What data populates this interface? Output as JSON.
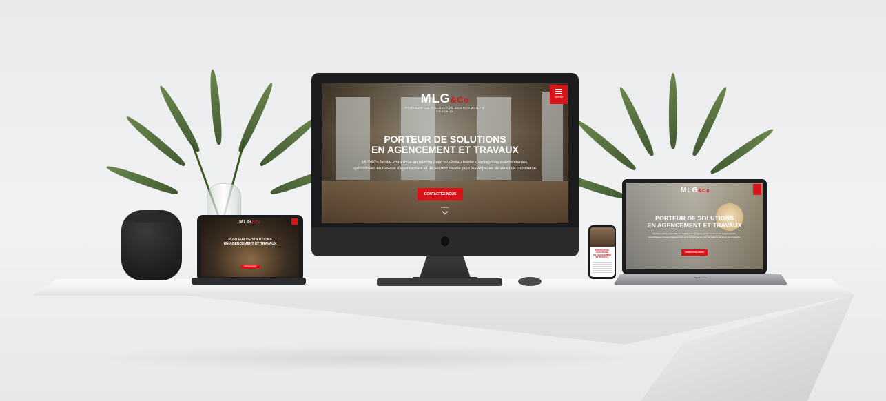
{
  "brand": {
    "logo_main": "MLG",
    "logo_accent": "&Co",
    "tagline": "PORTEUR DE SOLUTIONS AGENCEMENT & TRAVAUX",
    "accent_color": "#d8141b"
  },
  "hero": {
    "title_line1": "PORTEUR DE SOLUTIONS",
    "title_line2": "EN AGENCEMENT ET TRAVAUX",
    "subtitle_line1": "MLG&Co facilite votre mise en relation avec un réseau leader d'entreprises indépendantes,",
    "subtitle_line2": "spécialisées en travaux d'agencement et de second œuvre pour les espaces de vie et de commerce.",
    "cta_label": "CONTACTEZ-NOUS",
    "scroll_label": "SCROLL"
  },
  "menu": {
    "label": "MENU",
    "icon": "hamburger-icon"
  },
  "phone": {
    "title_line1": "PORTEUR DE",
    "title_line2": "SOLUTIONS",
    "title_line3": "EN AGENCEMENT",
    "title_line4": "ET TRAVAUX"
  },
  "laptop": {
    "label": "MacBook Pro"
  },
  "ipad": {
    "title_line1": "PORTEUR DE SOLUTIONS",
    "title_line2": "EN AGENCEMENT ET TRAVAUX",
    "cta_label": "CONTACTEZ-NOUS"
  }
}
